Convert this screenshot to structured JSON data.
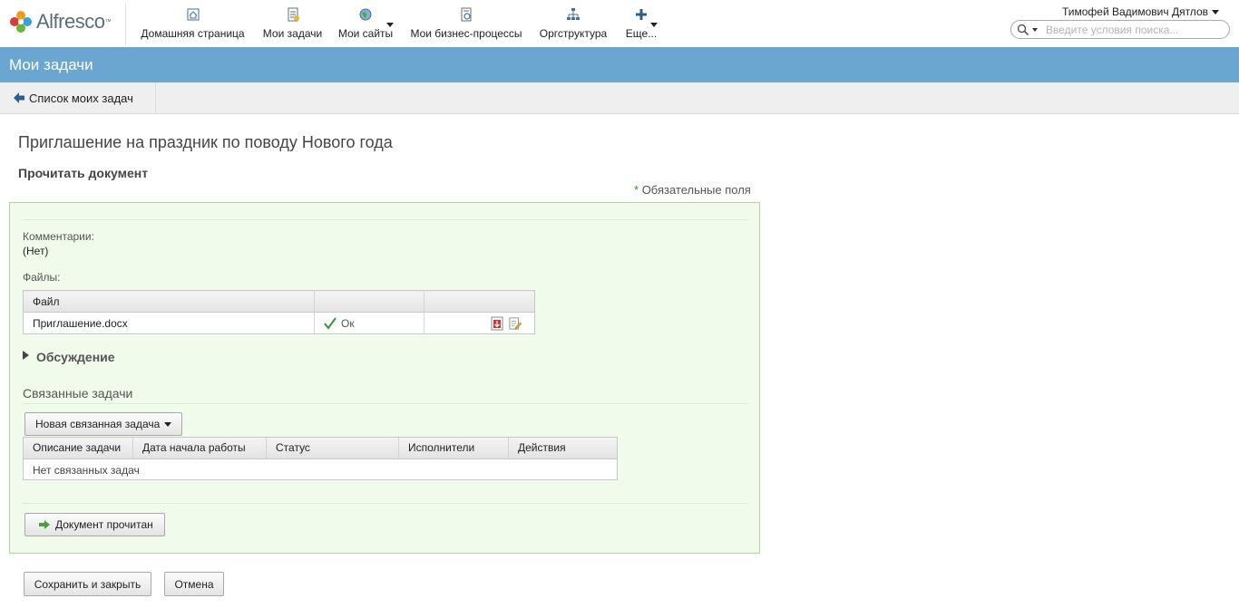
{
  "header": {
    "logo_text": "Alfresco",
    "logo_tm": "™",
    "nav": [
      {
        "label": "Домашняя страница",
        "icon": "home-icon"
      },
      {
        "label": "Мои задачи",
        "icon": "tasks-icon"
      },
      {
        "label": "Мои сайты",
        "icon": "sites-icon",
        "has_dropdown": true
      },
      {
        "label": "Мои бизнес-процессы",
        "icon": "workflows-icon"
      },
      {
        "label": "Оргструктура",
        "icon": "orgstructure-icon"
      },
      {
        "label": "Еще...",
        "icon": "plus-icon",
        "has_dropdown": true
      }
    ],
    "user_name": "Тимофей Вадимович Дятлов",
    "search_placeholder": "Введите условия поиска..."
  },
  "title_bar": {
    "title": "Мои задачи"
  },
  "back_bar": {
    "back_label": "Список моих задач"
  },
  "task": {
    "title": "Приглашение на праздник по поводу Нового года",
    "subtitle": "Прочитать документ",
    "required_star": "*",
    "required_note": "Обязательные поля"
  },
  "form": {
    "comments_label": "Комментарии:",
    "comments_value": "(Нет)",
    "files_label": "Файлы:",
    "files_table": {
      "columns": [
        "Файл",
        "",
        ""
      ],
      "rows": [
        {
          "file": "Приглашение.docx",
          "status": "Ок",
          "actions": [
            "download-icon",
            "edit-properties-icon"
          ]
        }
      ]
    },
    "discussion_label": "Обсуждение",
    "related_heading": "Связанные задачи",
    "new_related_button": "Новая связанная задача",
    "related_table": {
      "columns": [
        "Описание задачи",
        "Дата начала работы",
        "Статус",
        "Исполнители",
        "Действия"
      ],
      "empty_text": "Нет связанных задач"
    },
    "doc_read_button": "Документ прочитан"
  },
  "footer": {
    "save_button": "Сохранить и закрыть",
    "cancel_button": "Отмена"
  },
  "colors": {
    "title_bar": "#6aa6d0",
    "panel_bg": "#f0fbeb",
    "panel_border": "#b5d3a2",
    "accent_green": "#3b8e3b"
  }
}
